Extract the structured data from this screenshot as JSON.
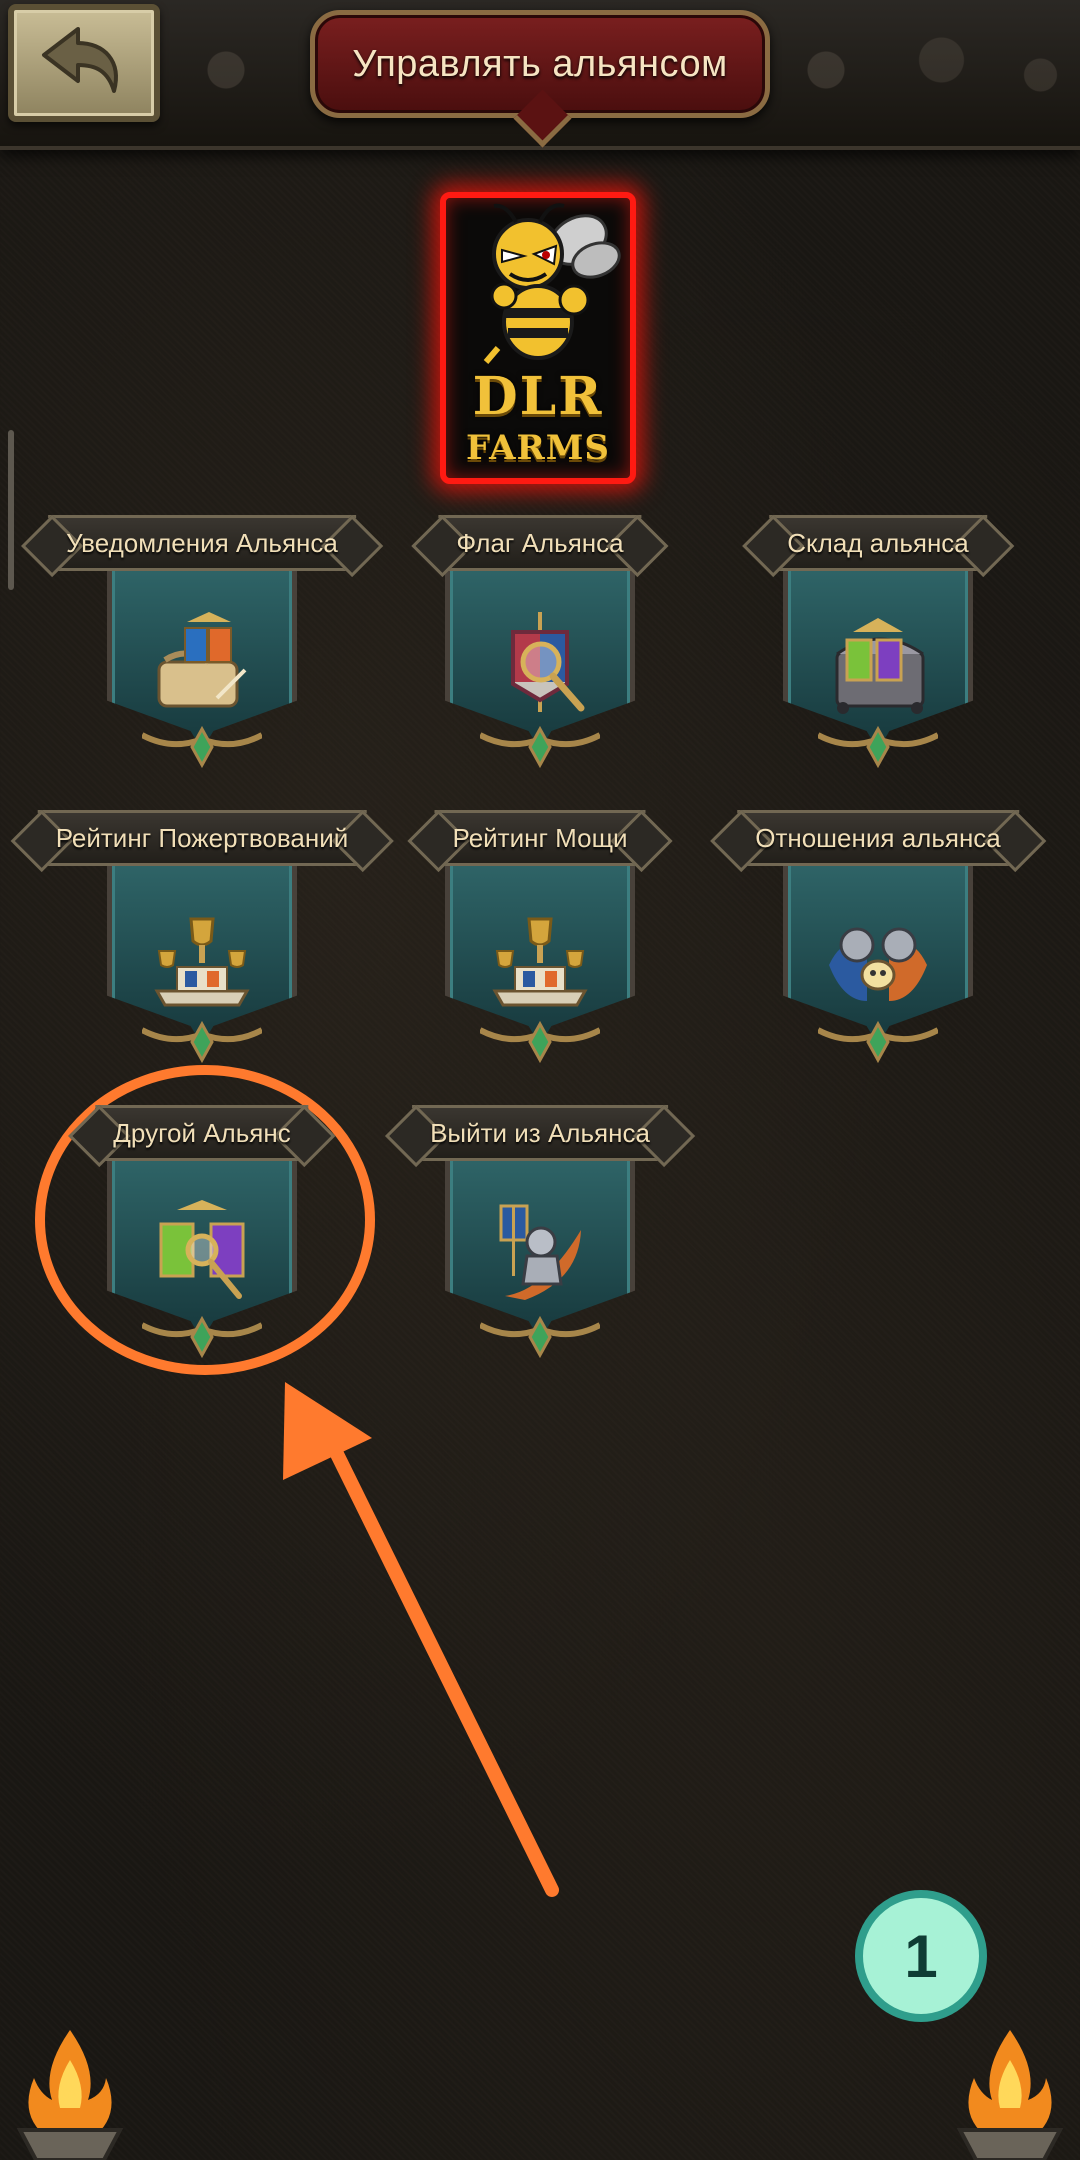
{
  "header": {
    "title": "Управлять альянсом",
    "back_icon": "back-arrow-icon"
  },
  "alliance": {
    "logo_line1": "DLR",
    "logo_line2": "FARMS",
    "logo_icon": "bee-mascot-icon",
    "frame_color": "#ff1a12"
  },
  "menu": {
    "items": [
      {
        "label": "Уведомления Альянса",
        "icon": "scroll-notifications-icon"
      },
      {
        "label": "Флаг Альянса",
        "icon": "banner-magnifier-icon"
      },
      {
        "label": "Склад альянса",
        "icon": "treasure-chest-icon"
      },
      {
        "label": "Рейтинг Пожертвований",
        "icon": "trophy-podium-icon"
      },
      {
        "label": "Рейтинг Мощи",
        "icon": "trophy-podium-icon"
      },
      {
        "label": "Отношения альянса",
        "icon": "knights-relations-icon"
      },
      {
        "label": "Другой Альянс",
        "icon": "banners-search-icon"
      },
      {
        "label": "Выйти из Альянса",
        "icon": "knight-exit-icon"
      }
    ]
  },
  "annotation": {
    "step_number": "1",
    "highlight_color": "#ff7a2e"
  },
  "colors": {
    "shield_teal": "#2f6568",
    "title_red": "#7a1f1f",
    "label_gold": "#f1dfb8"
  }
}
